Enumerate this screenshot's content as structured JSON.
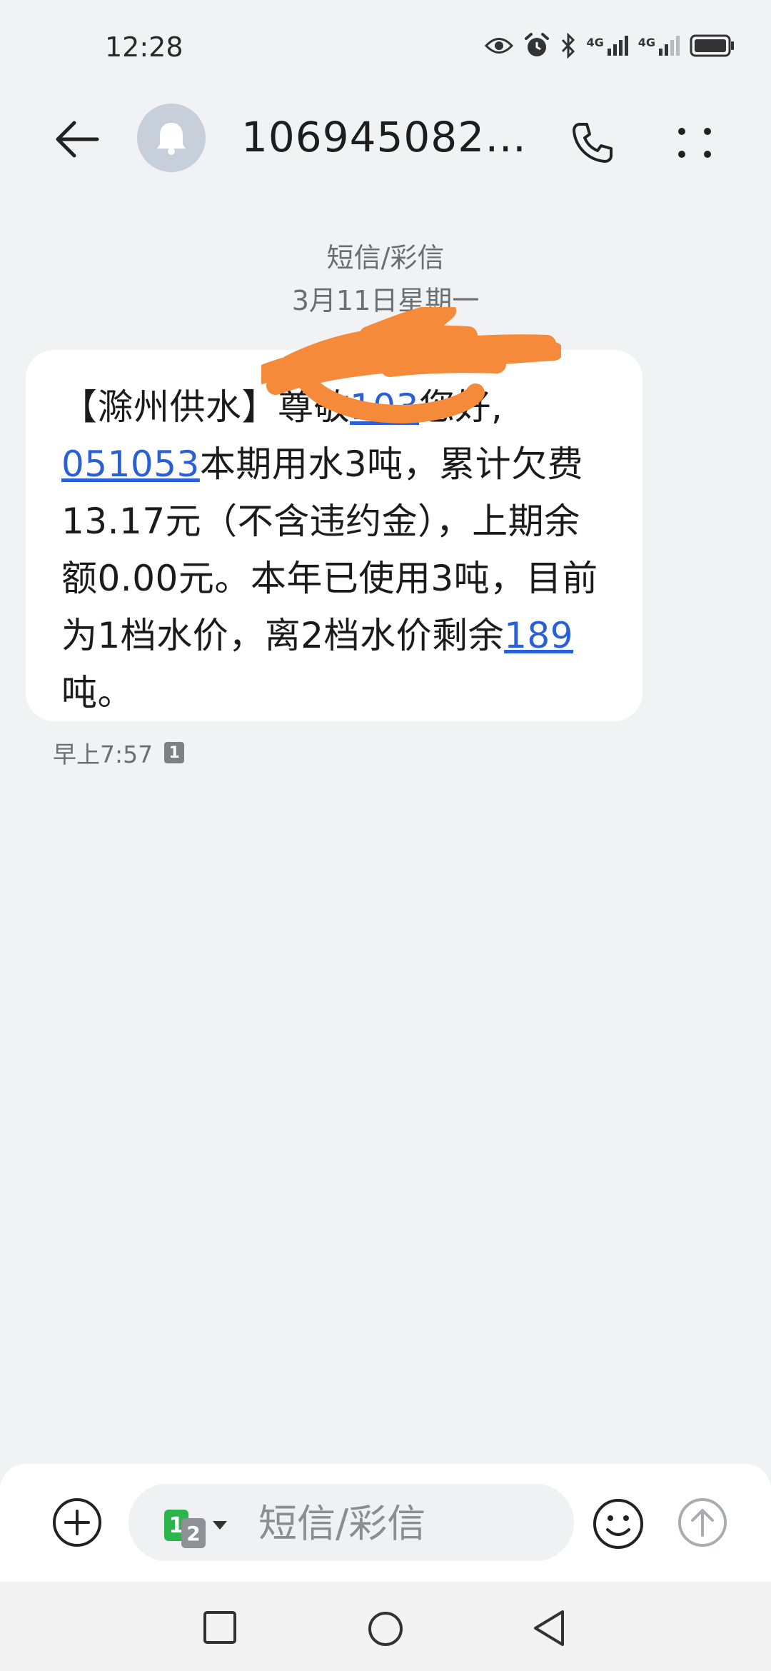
{
  "status_bar": {
    "time": "12:28",
    "icons": [
      "eye-icon",
      "alarm-icon",
      "bluetooth-icon",
      "signal-4g-icon",
      "signal-4g-icon",
      "battery-icon"
    ],
    "network_label_1": "4G",
    "network_label_2": "4G"
  },
  "header": {
    "contact": "1069450822...",
    "avatar_icon": "bell-icon"
  },
  "conversation": {
    "type_label": "短信/彩信",
    "date_label": "3月11日星期一"
  },
  "message": {
    "prefix": "【滁州供水】",
    "hidden_name": "尊敬",
    "link_1": "103",
    "after_link_1": "您好,",
    "link_2": "051053",
    "body_1": "本期用水3吨，累计欠费13.17元（不含违约金），上期余额0.00元。本年已使用3吨，目前为1档水价，离2档水价剩余",
    "link_3": "189",
    "body_2": "吨。",
    "time": "早上7:57",
    "sim": "1"
  },
  "composer": {
    "placeholder": "短信/彩信",
    "sim_primary": "1",
    "sim_secondary": "2"
  },
  "colors": {
    "background": "#f1f2f4",
    "bubble": "#ffffff",
    "link": "#2a5fd6",
    "redaction": "#f58a3a",
    "sim_green": "#2bb54a"
  }
}
